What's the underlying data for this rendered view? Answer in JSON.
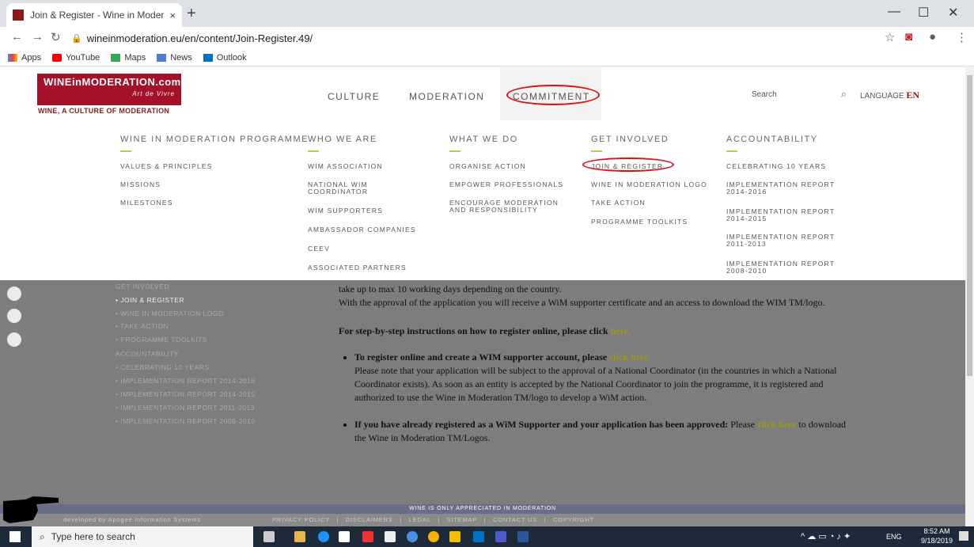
{
  "browser": {
    "tab_title": "Join & Register - Wine in Moder",
    "tab_close": "×",
    "new_tab": "+",
    "url": "wineinmoderation.eu/en/content/Join-Register.49/",
    "bookmarks": [
      "Apps",
      "YouTube",
      "Maps",
      "News",
      "Outlook"
    ]
  },
  "site": {
    "logo_main": "WINEinMODERATION.com",
    "logo_sub": "Art de Vivre",
    "tagline": "WINE, A CULTURE OF MODERATION",
    "nav": [
      "CULTURE",
      "MODERATION",
      "COMMITMENT"
    ],
    "search_placeholder": "Search",
    "language_label": "LANGUAGE",
    "language_value": "EN"
  },
  "mega_menu": {
    "columns": [
      {
        "heading": "WINE IN MODERATION PROGRAMME",
        "items": [
          "VALUES & PRINCIPLES",
          "MISSIONS",
          "MILESTONES"
        ]
      },
      {
        "heading": "WHO WE ARE",
        "items": [
          "WIM ASSOCIATION",
          "NATIONAL WIM COORDINATOR",
          "WIM SUPPORTERS",
          "AMBASSADOR COMPANIES",
          "CEEV",
          "ASSOCIATED PARTNERS"
        ]
      },
      {
        "heading": "WHAT WE DO",
        "items": [
          "ORGANISE ACTION",
          "EMPOWER PROFESSIONALS",
          "ENCOURAGE MODERATION AND RESPONSIBILITY"
        ]
      },
      {
        "heading": "GET INVOLVED",
        "items": [
          "JOIN & REGISTER",
          "WINE IN MODERATION LOGO",
          "TAKE ACTION",
          "PROGRAMME TOOLKITS"
        ]
      },
      {
        "heading": "ACCOUNTABILITY",
        "items": [
          "CELEBRATING 10 YEARS",
          "IMPLEMENTATION REPORT 2014-2016",
          "IMPLEMENTATION REPORT 2014-2015",
          "IMPLEMENTATION REPORT 2011-2013",
          "IMPLEMENTATION REPORT 2008-2010"
        ]
      }
    ]
  },
  "sidebar": {
    "items": [
      "GET INVOLVED",
      "• JOIN & REGISTER",
      "• WINE IN MODERATION LOGO",
      "• TAKE ACTION",
      "• PROGRAMME TOOLKITS",
      "ACCOUNTABILITY",
      "• CELEBRATING 10 YEARS",
      "• IMPLEMENTATION REPORT 2014-2016",
      "• IMPLEMENTATION REPORT 2014-2015",
      "• IMPLEMENTATION REPORT 2011-2013",
      "• IMPLEMENTATION REPORT 2008-2010"
    ]
  },
  "content": {
    "p1": "take up to max 10 working days depending on the country.",
    "p2": "With the approval of the application you will receive a WiM supporter certificate and an access to download the WIM TM/logo.",
    "p3_text": "For step-by-step instructions on how to register online, please click ",
    "p3_link": "here.",
    "b1_bold": "To register online and create a WIM supporter account, please ",
    "b1_link": "click here.",
    "b1_text": "Please note that your application will be subject to the approval of a National Coordinator (in the countries in which a National Coordinator exists). As soon as an entity is accepted by the National Coordinator to join the programme, it is registered and authorized to use the Wine in Moderation TM/logo to develop a WiM action.",
    "b2_bold": "If you have already registered as a WiM Supporter and your application has been approved:",
    "b2_text": " Please ",
    "b2_link": "click here",
    "b2_tail": " to download the Wine in Moderation TM/Logos."
  },
  "footer": {
    "banner": "WINE IS ONLY APPRECIATED IN MODERATION",
    "developed": "developed by Apogee Information Systems",
    "links": "PRIVACY POLICY   |   DISCLAIMERS   |   LEGAL   |   SITEMAP   |   CONTACT US   |   COPYRIGHT"
  },
  "taskbar": {
    "search": "Type here to search",
    "lang": "ENG",
    "time": "8:52 AM",
    "date": "9/18/2019"
  }
}
